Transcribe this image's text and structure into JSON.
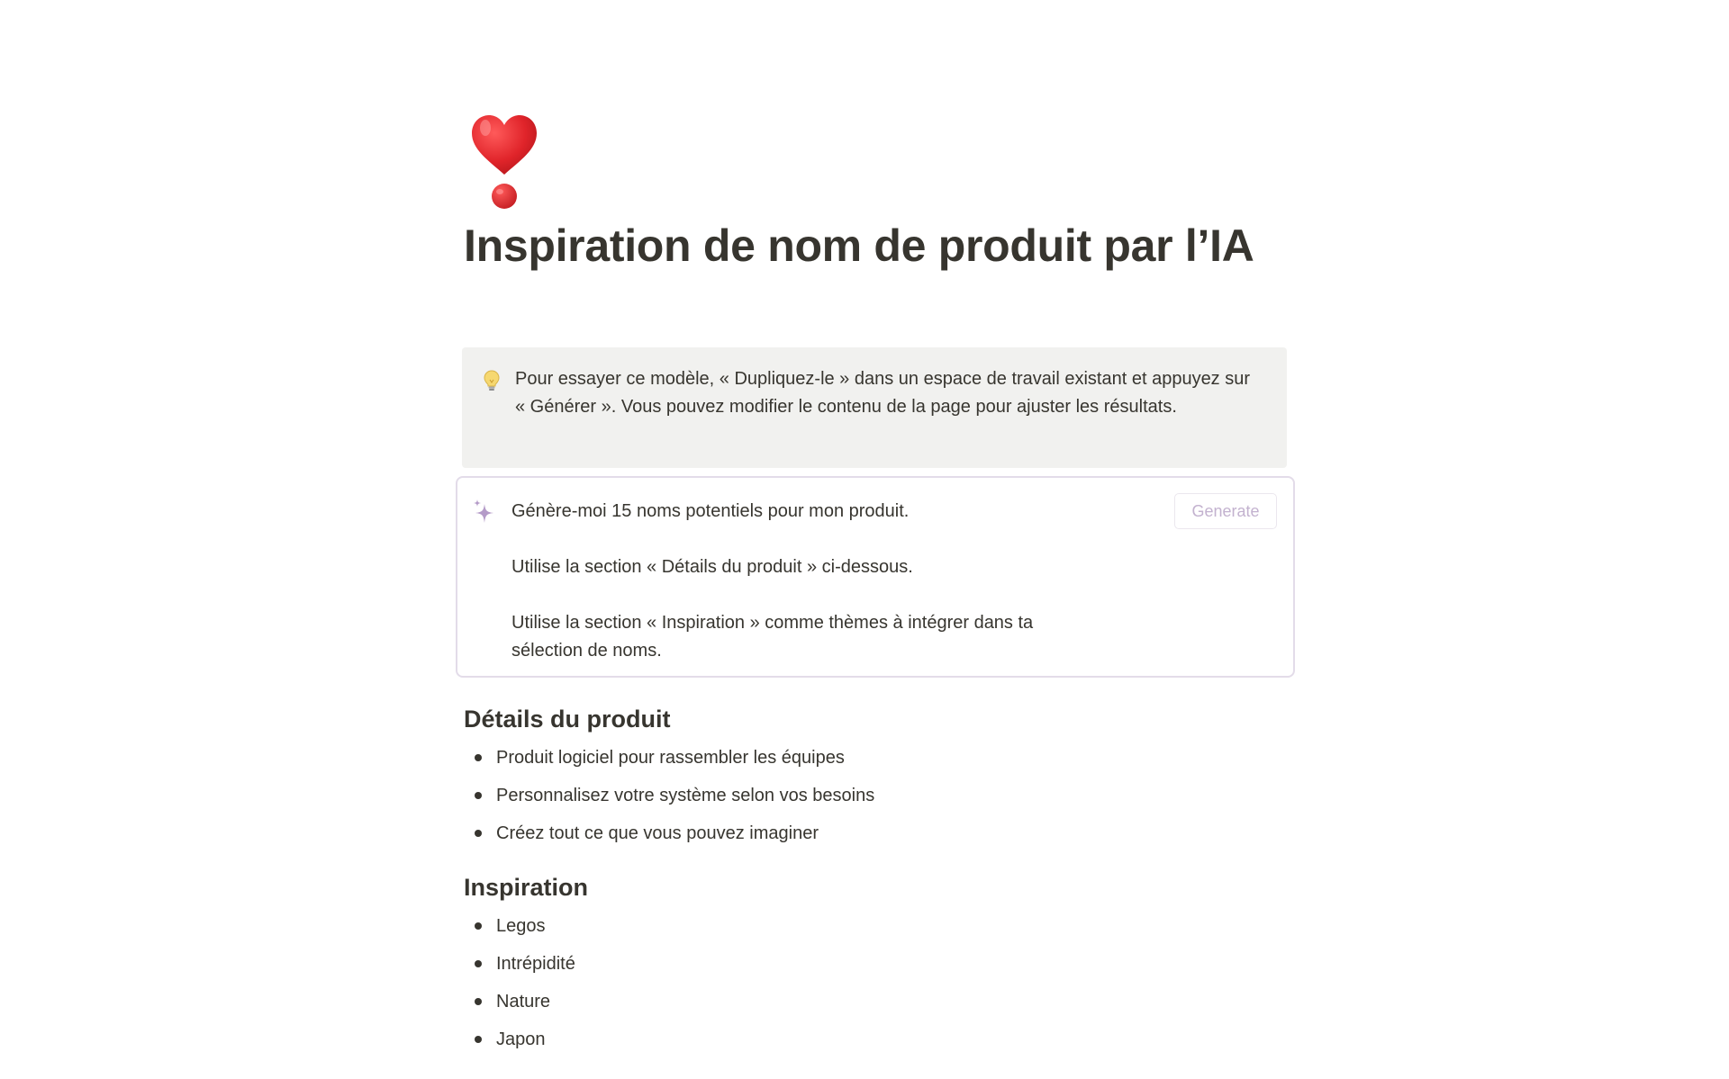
{
  "page": {
    "icon": "heavy-exclamation-heart-emoji",
    "title": "Inspiration de nom de produit par l’IA"
  },
  "callout": {
    "icon": "lightbulb-icon",
    "text": "Pour essayer ce modèle, « Dupliquez-le » dans un espace de travail existant et appuyez sur « Générer ». Vous pouvez modifier le contenu de la page pour ajuster les résultats."
  },
  "ai_block": {
    "icon": "sparkle-icon",
    "prompt_lines": [
      "Génère-moi 15 noms potentiels pour mon produit.",
      "Utilise la section « Détails du produit » ci-dessous.",
      "Utilise la section « Inspiration » comme thèmes à intégrer dans ta sélection de noms."
    ],
    "generate_label": "Generate"
  },
  "sections": [
    {
      "heading": "Détails du produit",
      "items": [
        "Produit logiciel pour rassembler les équipes",
        "Personnalisez votre système selon vos besoins",
        "Créez tout ce que vous pouvez imaginer"
      ]
    },
    {
      "heading": "Inspiration",
      "items": [
        "Legos",
        "Intrépidité",
        "Nature",
        "Japon"
      ]
    }
  ],
  "colors": {
    "text": "#37352f",
    "callout_bg": "#f1f1ef",
    "ai_border": "#e3dce9",
    "generate_text": "#c3b2cf",
    "sparkle": "#b49bc8",
    "heart": "#e0242a"
  }
}
